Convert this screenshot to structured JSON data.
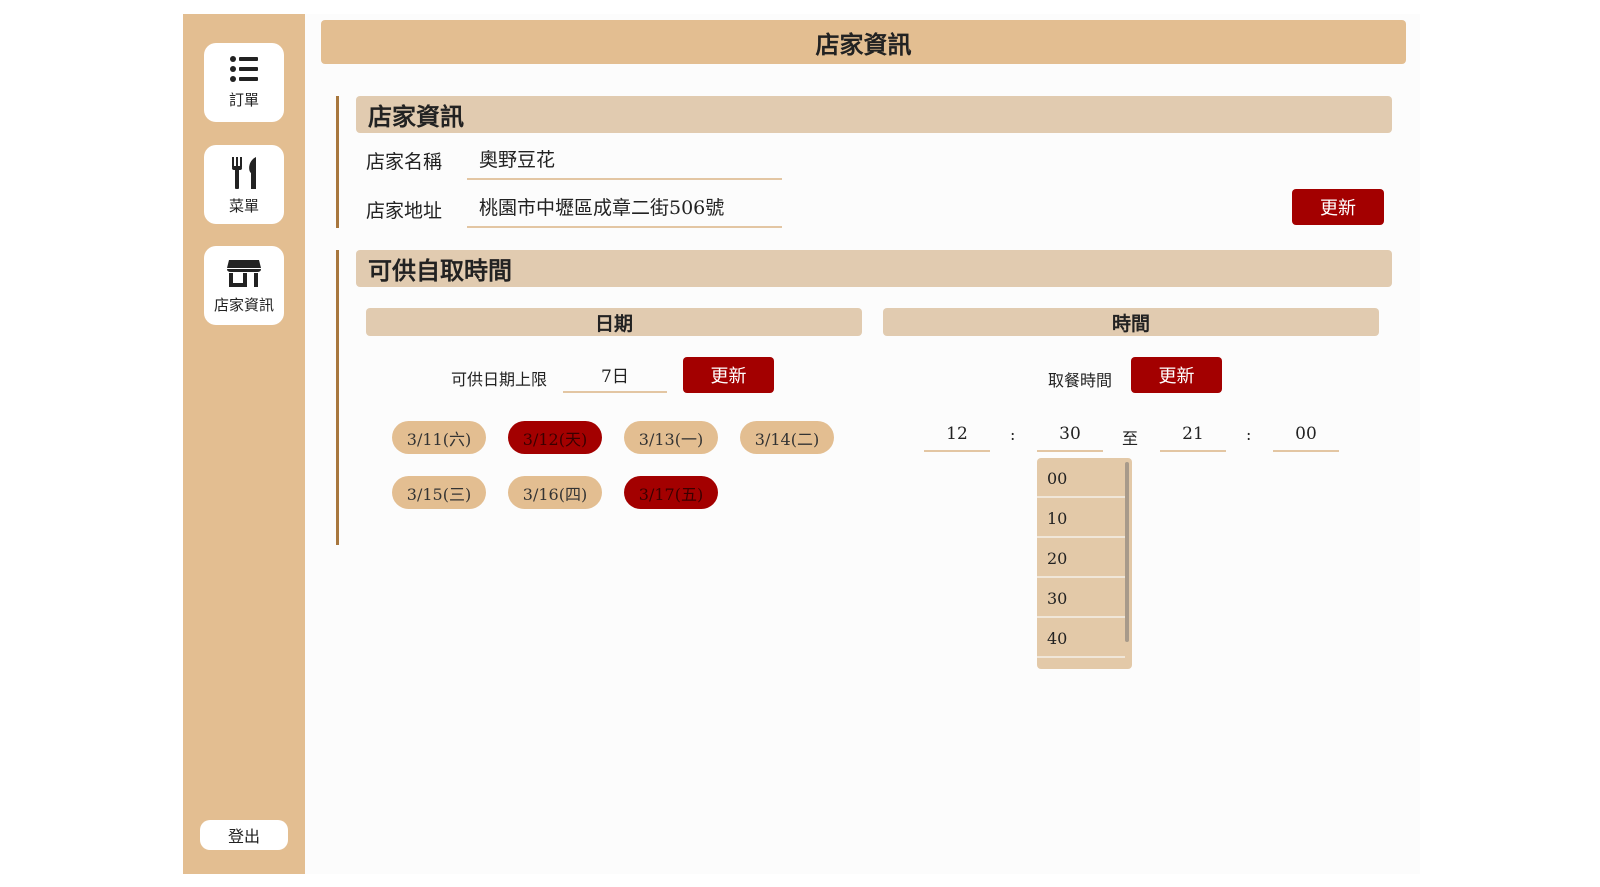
{
  "sidebar": {
    "items": [
      {
        "label": "訂單",
        "icon": "list-icon"
      },
      {
        "label": "菜單",
        "icon": "utensils-icon"
      },
      {
        "label": "店家資訊",
        "icon": "store-icon"
      }
    ],
    "logout_label": "登出"
  },
  "header": {
    "title": "店家資訊"
  },
  "store_info": {
    "section_title": "店家資訊",
    "name_label": "店家名稱",
    "name_value": "奧野豆花",
    "address_label": "店家地址",
    "address_value": "桃園市中壢區成章二街506號",
    "update_label": "更新"
  },
  "pickup": {
    "section_title": "可供自取時間",
    "date_header": "日期",
    "time_header": "時間",
    "date_limit_label": "可供日期上限",
    "date_limit_value": "7日",
    "date_update_label": "更新",
    "pickup_time_label": "取餐時間",
    "time_update_label": "更新",
    "dates": [
      {
        "label": "3/11(六)",
        "enabled": true
      },
      {
        "label": "3/12(天)",
        "enabled": false
      },
      {
        "label": "3/13(一)",
        "enabled": true
      },
      {
        "label": "3/14(二)",
        "enabled": true
      },
      {
        "label": "3/15(三)",
        "enabled": true
      },
      {
        "label": "3/16(四)",
        "enabled": true
      },
      {
        "label": "3/17(五)",
        "enabled": false
      }
    ],
    "time_range": {
      "start_hour": "12",
      "start_minute": "30",
      "separator": "至",
      "end_hour": "21",
      "end_minute": "00",
      "colon": ":"
    },
    "minute_options": [
      "00",
      "10",
      "20",
      "30",
      "40"
    ]
  },
  "colors": {
    "sidebar_bg": "#e3be91",
    "accent_red": "#a30000",
    "section_header_bg": "#e1cbb0",
    "divider_brown": "#a8773e"
  }
}
